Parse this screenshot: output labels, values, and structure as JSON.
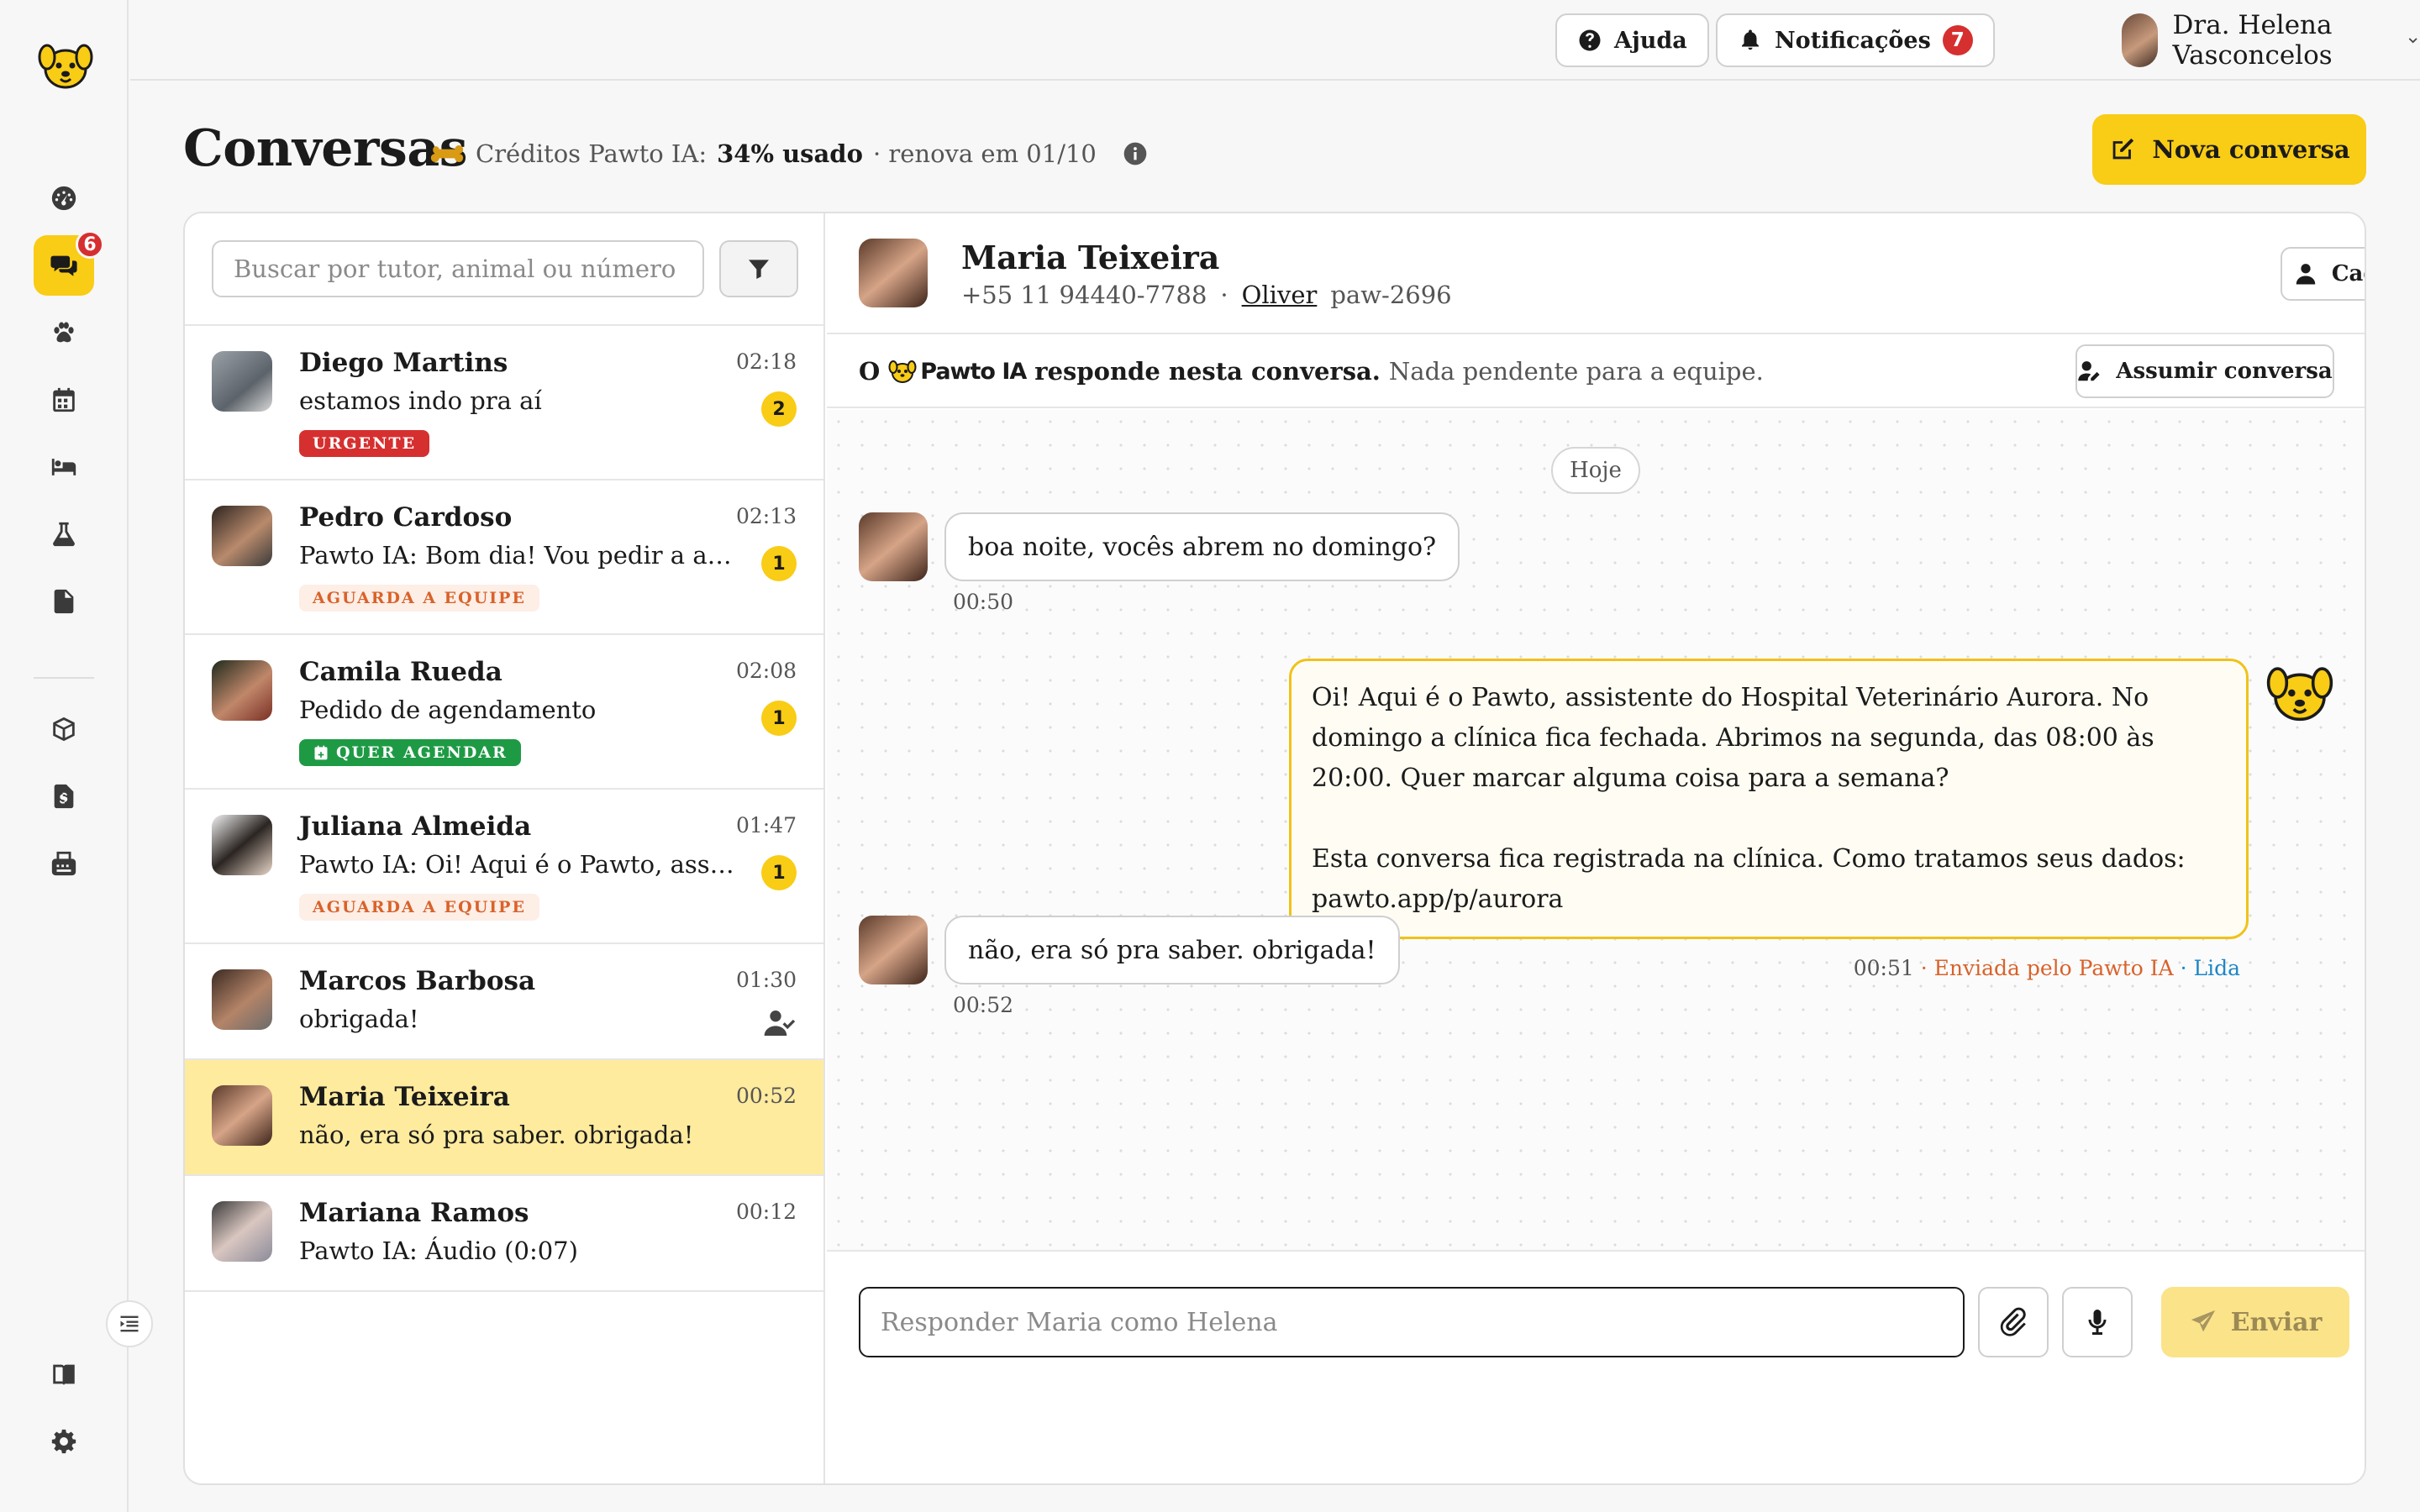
{
  "app": {
    "brand_color": "#f9cc15"
  },
  "sidebar": {
    "chat_badge": "6",
    "icons": [
      "dashboard-icon",
      "chat-icon",
      "paw-icon",
      "calendar-icon",
      "bed-icon",
      "flask-icon",
      "document-icon",
      "box-icon",
      "invoice-icon",
      "fax-icon",
      "book-icon",
      "settings-icon"
    ]
  },
  "topbar": {
    "help_label": "Ajuda",
    "notifications_label": "Notificações",
    "notifications_count": "7",
    "user_name": "Dra. Helena Vasconcelos"
  },
  "page": {
    "title": "Conversas",
    "credits_prefix": "Créditos Pawto IA:",
    "credits_used": "34% usado",
    "credits_suffix": "· renova em 01/10",
    "new_conversation": "Nova conversa"
  },
  "search": {
    "placeholder": "Buscar por tutor, animal ou número"
  },
  "conversations": [
    {
      "name": "Diego Martins",
      "time": "02:18",
      "preview": "estamos indo pra aí",
      "unread": "2",
      "tag": "URGENTE"
    },
    {
      "name": "Pedro Cardoso",
      "time": "02:13",
      "preview": "Pawto IA: Bom dia! Vou pedir a atualização",
      "unread": "1",
      "tag": "AGUARDA A EQUIPE"
    },
    {
      "name": "Camila Rueda",
      "time": "02:08",
      "preview": "Pedido de agendamento",
      "unread": "1",
      "tag": "QUER AGENDAR"
    },
    {
      "name": "Juliana Almeida",
      "time": "01:47",
      "preview": "Pawto IA: Oi! Aqui é o Pawto, assistente do Hospital",
      "unread": "1",
      "tag": "AGUARDA A EQUIPE"
    },
    {
      "name": "Marcos Barbosa",
      "time": "01:30",
      "preview": "obrigada!"
    },
    {
      "name": "Maria Teixeira",
      "time": "00:52",
      "preview": "não, era só pra saber. obrigada!"
    },
    {
      "name": "Mariana Ramos",
      "time": "00:12",
      "preview": "Pawto IA: Áudio (0:07)"
    }
  ],
  "chat": {
    "name": "Maria Teixeira",
    "phone": "+55 11 94440-7788",
    "separator": "·",
    "pet": "Oliver",
    "pet_id": "paw-2696",
    "profile_button": "Cadastro",
    "ai_bar_o": "O",
    "ai_brand": "Pawto IA",
    "ai_bar_bold": "responde nesta conversa.",
    "ai_bar_rest": "Nada pendente para a equipe.",
    "take_over_button": "Assumir conversa",
    "day_label": "Hoje",
    "messages": {
      "in1_text": "boa noite, vocês abrem no domingo?",
      "in1_time": "00:50",
      "out_para1": "Oi! Aqui é o Pawto, assistente do Hospital Veterinário Aurora. No domingo a clínica fica fechada. Abrimos na segunda, das 08:00 às 20:00. Quer marcar alguma coisa para a semana?",
      "out_para2": "Esta conversa fica registrada na clínica. Como tratamos seus dados: pawto.app/p/aurora",
      "out_time": "00:51",
      "out_sent": "· Enviada pelo Pawto IA",
      "out_read": "· Lida",
      "in2_text": "não, era só pra saber. obrigada!",
      "in2_time": "00:52"
    },
    "reply_placeholder": "Responder Maria como Helena",
    "send_label": "Enviar"
  }
}
